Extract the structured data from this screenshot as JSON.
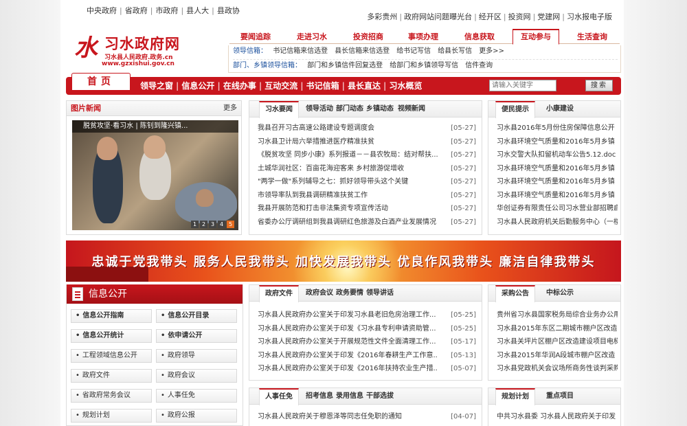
{
  "top_left_links": [
    "中央政府",
    "省政府",
    "市政府",
    "县人大",
    "县政协"
  ],
  "top_right_links": [
    "多彩贵州",
    "政府网站问题曝光台",
    "经开区",
    "投资网",
    "党建网",
    "习水报电子版"
  ],
  "logo": {
    "mark": "水",
    "title": "习水政府网",
    "subtitle": "习水县人民政府.政务.cn",
    "url": "www.gzxishui.gov.cn"
  },
  "main_tabs": [
    {
      "label": "要闻追踪",
      "active": false
    },
    {
      "label": "走进习水",
      "active": false
    },
    {
      "label": "投资招商",
      "active": false
    },
    {
      "label": "事项办理",
      "active": false
    },
    {
      "label": "信息获取",
      "active": false
    },
    {
      "label": "互动参与",
      "active": true
    },
    {
      "label": "生活查询",
      "active": false
    }
  ],
  "subnav": {
    "row1_label": "领导信箱：",
    "row1_items": [
      "书记信箱来信选登",
      "县长信箱来信选登",
      "给书记写信",
      "给县长写信",
      "更多>>"
    ],
    "row2_label": "部门、乡镇领导信箱：",
    "row2_items": [
      "部门和乡镇信件回复选登",
      "给部门和乡镇领导写信",
      "信件查询"
    ]
  },
  "navbar": {
    "home": "首页",
    "items": [
      "领导之窗",
      "信息公开",
      "在线办事",
      "互动交流",
      "书记信箱",
      "县长直达",
      "习水概览"
    ],
    "search_placeholder": "请输入关键字",
    "search_button": "搜索"
  },
  "picture_news": {
    "title": "图片新闻",
    "more": "更多",
    "caption": "脱贫攻坚·看习水 | 陈钊到隆兴镇...",
    "pages": [
      "1",
      "2",
      "3",
      "4",
      "5"
    ]
  },
  "news": {
    "tabs": [
      "习水要闻",
      "领导活动",
      "部门动态",
      "乡镇动态",
      "视频新闻"
    ],
    "items": [
      {
        "title": "我县召开习古高速公路建设专题调度会",
        "date": "[05-27]"
      },
      {
        "title": "习水县卫计局六举措推进医疗精准扶贫",
        "date": "[05-27]"
      },
      {
        "title": "《脱贫攻坚 同步小康》系列报道－－县农牧局：结对帮扶...",
        "date": "[05-27]"
      },
      {
        "title": "土城华润社区：百亩花海迎客来 乡村旅游促增收",
        "date": "[05-27]"
      },
      {
        "title": "\"两学一做\"系列辅导之七：抓好领导带头这个关键",
        "date": "[05-27]"
      },
      {
        "title": "市领导率队到我县调研精准扶贫工作",
        "date": "[05-27]"
      },
      {
        "title": "我县开展防范和打击非法集资专项宣传活动",
        "date": "[05-27]"
      },
      {
        "title": "省委办公厅调研组到我县调研红色旅游及白酒产业发展情况",
        "date": "[05-27]"
      }
    ]
  },
  "convenience": {
    "tabs": [
      "便民提示",
      "小康建设"
    ],
    "items": [
      "习水县2016年5月份住房保障信息公开",
      "习水县环境空气质量和2016年5月乡镇",
      "习水交警大队扣留机动车公告5.12.doc",
      "习水县环境空气质量和2016年5月乡镇",
      "习水县环境空气质量和2016年5月乡镇",
      "习水县环境空气质量和2016年5月乡镇",
      "华创证券有限责任公司习水营业部招聘启",
      "习水县人民政府机关后勤服务中心（一楼"
    ]
  },
  "banner": {
    "text": "忠诚于党我带头  服务人民我带头  加快发展我带头  优良作风我带头  廉洁自律我带头"
  },
  "info_open": {
    "title": "信息公开",
    "buttons": [
      {
        "label": "信息公开指南",
        "bold": true
      },
      {
        "label": "信息公开目录",
        "bold": true
      },
      {
        "label": "信息公开统计",
        "bold": true
      },
      {
        "label": "依申请公开",
        "bold": true
      },
      {
        "label": "工程领域信息公开",
        "bold": false
      },
      {
        "label": "政府领导",
        "bold": false
      },
      {
        "label": "政府文件",
        "bold": false
      },
      {
        "label": "政府会议",
        "bold": false
      },
      {
        "label": "省政府常务会议",
        "bold": false
      },
      {
        "label": "人事任免",
        "bold": false
      },
      {
        "label": "规划计划",
        "bold": false
      },
      {
        "label": "政府公报",
        "bold": false
      }
    ]
  },
  "gov_docs": {
    "tabs": [
      "政府文件",
      "政府会议",
      "政务要情",
      "领导讲话"
    ],
    "items": [
      {
        "title": "习水县人民政府办公室关于印发习水县老旧危房治理工作...",
        "date": "[05-25]"
      },
      {
        "title": "习水县人民政府办公室关于印发《习水县专利申请资助管...",
        "date": "[05-25]"
      },
      {
        "title": "习水县人民政府办公室关于开展规范性文件全面清理工作...",
        "date": "[05-17]"
      },
      {
        "title": "习水县人民政府办公室关于印发《2016年春耕生产工作意...",
        "date": "[05-13]"
      },
      {
        "title": "习水县人民政府办公室关于印发《2016年扶持农业生产措...",
        "date": "[05-07]"
      }
    ]
  },
  "procurement": {
    "tabs": [
      "采购公告",
      "中标公示"
    ],
    "items": [
      "贵州省习水县国家税务局综合业务办公用",
      "习水县2015年东区二期城市棚户区改造",
      "习水县关坪片区棚户区改造建设项目电梯",
      "习水县2015年华润A段城市棚户区改造",
      "习水县党政机关会议场所商务性谈判采购"
    ]
  },
  "personnel": {
    "tabs": [
      "人事任免",
      "招考信息",
      "录用信息",
      "干部选拔"
    ],
    "items": [
      {
        "title": "习水县人民政府关于穆恩泽等同志任免职的通知",
        "date": "[04-07]"
      }
    ]
  },
  "planning": {
    "tabs": [
      "规划计划",
      "重点项目"
    ],
    "items": [
      "中共习水县委 习水县人民政府关于印发"
    ]
  }
}
